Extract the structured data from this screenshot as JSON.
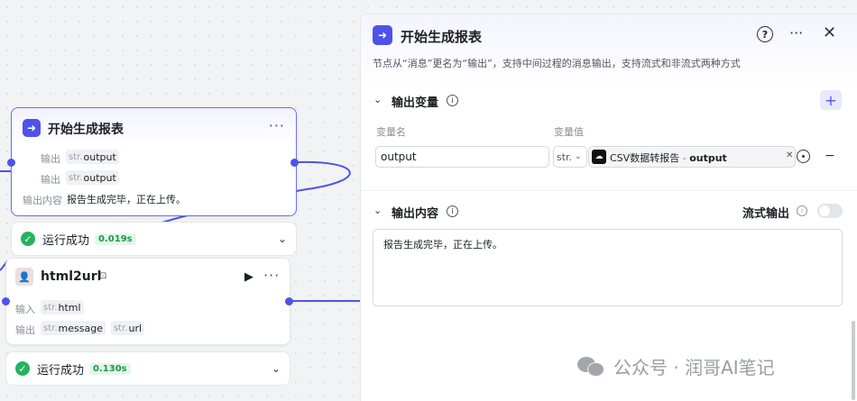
{
  "canvas": {
    "node_start": {
      "title": "开始生成报表",
      "rows": [
        {
          "label": "输出",
          "chips": [
            {
              "type": "str.",
              "name": "output"
            }
          ]
        },
        {
          "label": "输出",
          "chips": [
            {
              "type": "str.",
              "name": "output"
            }
          ]
        }
      ],
      "content_label": "输出内容",
      "content_value": "报告生成完毕，正在上传。",
      "run_status": "运行成功",
      "run_time": "0.019s"
    },
    "node_html2url": {
      "title": "html2url",
      "rows": [
        {
          "label": "输入",
          "chips": [
            {
              "type": "str.",
              "name": "html"
            }
          ]
        },
        {
          "label": "输出",
          "chips": [
            {
              "type": "str.",
              "name": "message"
            },
            {
              "type": "str.",
              "name": "url"
            }
          ]
        }
      ],
      "run_status": "运行成功",
      "run_time": "0.130s"
    }
  },
  "panel": {
    "title": "开始生成报表",
    "description": "节点从“消息”更名为“输出”，支持中间过程的消息输出，支持流式和非流式两种方式",
    "output_vars": {
      "title": "输出变量",
      "col_name": "变量名",
      "col_value": "变量值",
      "name_value": "output",
      "type_value": "str.",
      "ref_source": "CSV数据转报告",
      "ref_sep": "-",
      "ref_var": "output"
    },
    "output_content": {
      "title": "输出内容",
      "stream_label": "流式输出",
      "text": "报告生成完毕，正在上传。"
    }
  },
  "watermark": {
    "text": "公众号 · 润哥AI笔记"
  },
  "colors": {
    "accent": "#4d53e8",
    "success": "#25b35f"
  }
}
